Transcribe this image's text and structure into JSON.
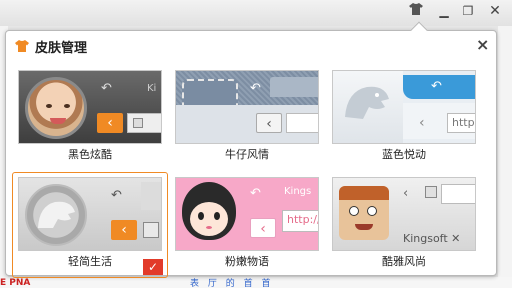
{
  "window": {
    "skin_icon": "shirt-icon",
    "min_label": "▁",
    "max_label": "❐",
    "close_label": "✕"
  },
  "background": {
    "bottom_text": "表 厅 的 首 首",
    "left_text": "E PNA"
  },
  "panel": {
    "title": "皮肤管理",
    "close_label": "×"
  },
  "skins": [
    {
      "label": "黑色炫酷",
      "tab_text": "Ki",
      "selected": false
    },
    {
      "label": "牛仔风情",
      "tab_text": "",
      "selected": false
    },
    {
      "label": "蓝色悦动",
      "address_text": "http",
      "selected": false
    },
    {
      "label": "轻简生活",
      "tab_text": "",
      "selected": true,
      "check_mark": "✓"
    },
    {
      "label": "粉嫩物语",
      "tab_text": "Kings",
      "address_text": "http://",
      "selected": false
    },
    {
      "label": "酷雅风尚",
      "tab_text": "Kingsoft ✕",
      "selected": false
    }
  ],
  "colors": {
    "accent_orange": "#f08a24",
    "check_red": "#e23b2a",
    "pink": "#f7a8c8",
    "blue": "#3a9ad9"
  }
}
